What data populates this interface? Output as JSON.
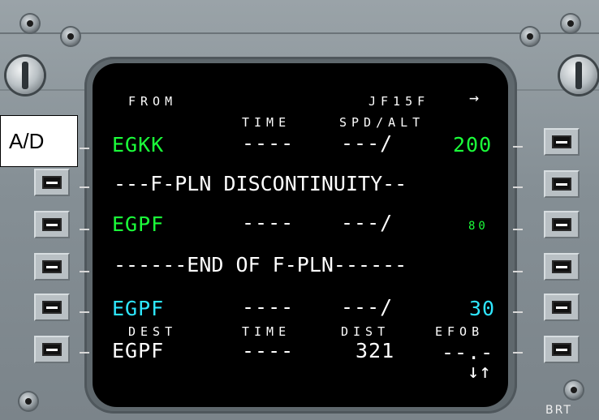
{
  "overlay_label": "A/D",
  "bezel": {
    "brt_label": "BRT"
  },
  "mcdu": {
    "header": {
      "from_label": "FROM",
      "flight_id": "JF15F",
      "arrow": "→"
    },
    "col_headers_top": {
      "time": "TIME",
      "spd_alt": "SPD/ALT"
    },
    "rows": [
      {
        "ident": "EGKK",
        "time": "----",
        "spd": "---/",
        "alt": "200",
        "color": "#1bff3a"
      },
      {
        "text": "---F-PLN DISCONTINUITY--"
      },
      {
        "ident": "EGPF",
        "time": "----",
        "spd": "---/",
        "alt": "80",
        "color": "#1bff3a"
      },
      {
        "text": "------END OF F-PLN------"
      },
      {
        "ident": "EGPF",
        "time": "----",
        "spd": "---/",
        "alt": "30",
        "color": "#2ee6ff"
      }
    ],
    "col_headers_bottom": {
      "dest": "DEST",
      "time": "TIME",
      "dist": "DIST",
      "efob": "EFOB"
    },
    "dest_row": {
      "ident": "EGPF",
      "time": "----",
      "dist": "321",
      "efob": "--.-"
    },
    "scroll_arrows": "↓↑"
  }
}
